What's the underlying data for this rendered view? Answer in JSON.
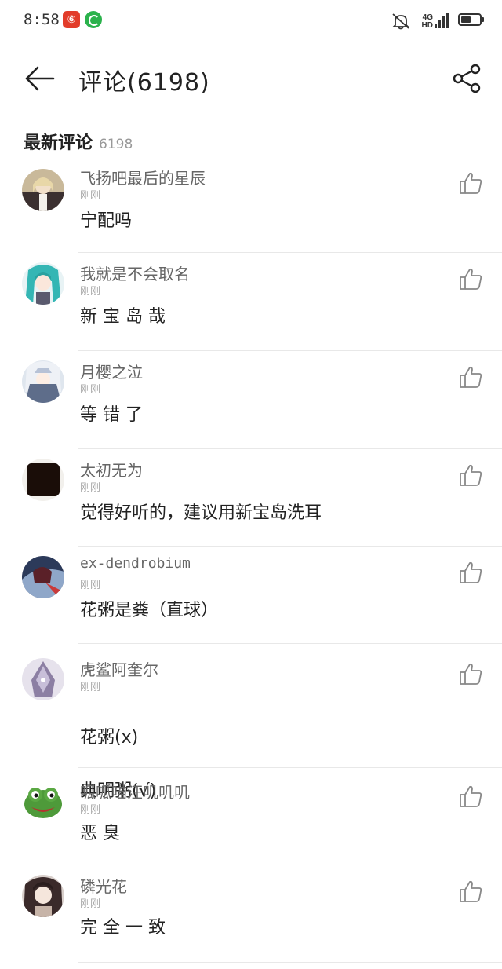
{
  "status_bar": {
    "time": "8:58",
    "network_top": "4G",
    "network_hd": "HD",
    "app_red_glyph": "⑥"
  },
  "header": {
    "title": "评论(6198)"
  },
  "section": {
    "title": "最新评论",
    "count": "6198"
  },
  "comments": [
    {
      "nickname": "飞扬吧最后的星辰",
      "time": "刚刚",
      "content": "宁配吗"
    },
    {
      "nickname": "我就是不会取名",
      "time": "刚刚",
      "content": "新 宝 岛 哉"
    },
    {
      "nickname": "月樱之泣",
      "time": "刚刚",
      "content": "等 错 了"
    },
    {
      "nickname": "太初无为",
      "time": "刚刚",
      "content": "觉得好听的，建议用新宝岛洗耳"
    },
    {
      "nickname": "ex-dendrobium",
      "time": "刚刚",
      "content": "花粥是粪（直球）"
    },
    {
      "nickname": "虎鲨阿奎尔",
      "time": "刚刚",
      "content_line1": "花粥(x)",
      "content_line2": "典明粥(√)"
    },
    {
      "nickname": "呱呱喵汪叽叽叽",
      "time": "刚刚",
      "content": "恶 臭"
    },
    {
      "nickname": "磷光花",
      "time": "刚刚",
      "content": "完  全  一  致"
    }
  ],
  "colors": {
    "text_primary": "#222222",
    "text_secondary": "#666666",
    "text_muted": "#aaaaaa",
    "divider": "#e8e8e8"
  },
  "icons": {
    "back": "arrow-left-icon",
    "share": "share-icon",
    "like": "thumbs-up-icon",
    "mute": "bell-off-icon",
    "signal": "signal-bars-icon",
    "battery": "battery-icon"
  }
}
